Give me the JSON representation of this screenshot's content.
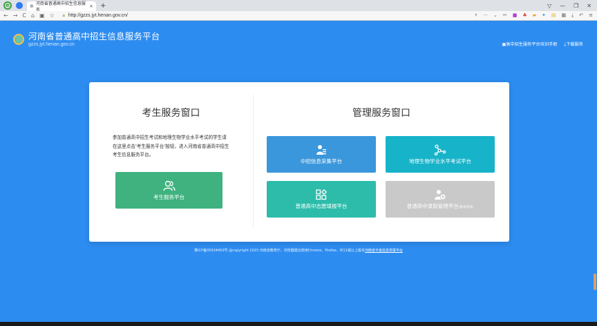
{
  "browser": {
    "tab_title": "河南省普通高中招生信息服务",
    "url": "http://gzzs.jyt.henan.gov.cn/"
  },
  "header": {
    "title": "河南省普通高中招生信息服务平台",
    "subtitle": "gzzs.jyt.henan.gov.cn",
    "links": [
      "高中招生服务平台培训手册",
      "下载服务"
    ]
  },
  "left": {
    "title": "考生服务窗口",
    "description": "参加普通高中招生考试和地理生物学业水平考试的学生请在这里点击'考生服务平台'按钮，进入河南省普通高中招生考生信息服务平台。",
    "button_label": "考生服务平台"
  },
  "right": {
    "title": "管理服务窗口",
    "buttons": {
      "info": "中招信息采集平台",
      "geo": "地理生物学业水平考试平台",
      "wish": "普通高中志愿填报平台",
      "admit": "普通高中录取管理平台",
      "admit_note": "(暂未开放)"
    }
  },
  "footer": {
    "text": "豫ICP备05024450号 @copyright 2023 河南省教育厅，浏览器建议使用Chrome、Firefox、IE11或以上版本",
    "link": "河南省不良信息举报平台"
  },
  "colors": {
    "page_bg": "#2d8cf0",
    "student_button": "#3fb27f",
    "info_button": "#3a97dc",
    "geo_button": "#17b3c9",
    "wish_button": "#2dbcaa",
    "admit_button_disabled": "#c9c9c9"
  }
}
